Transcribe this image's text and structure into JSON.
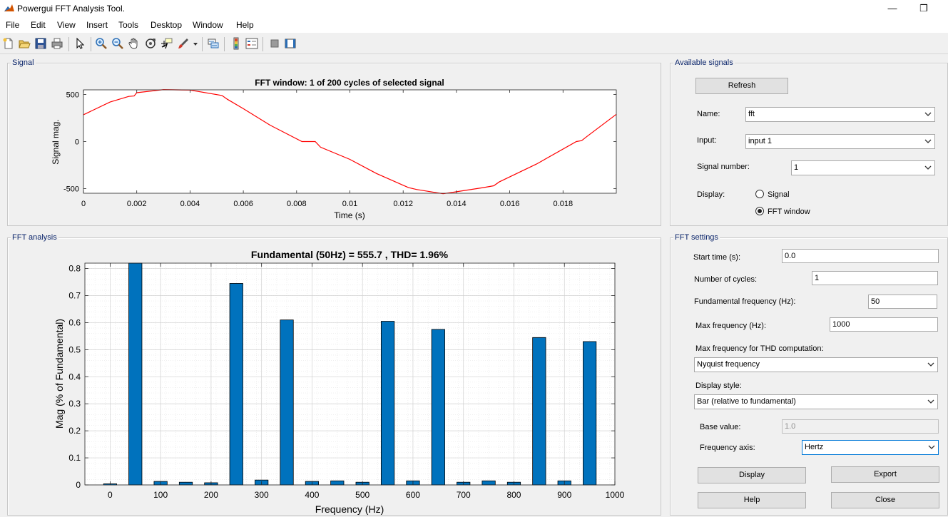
{
  "window": {
    "title": "Powergui FFT Analysis Tool.",
    "minimize_glyph": "—",
    "restore_glyph": "❐"
  },
  "menu": [
    "File",
    "Edit",
    "View",
    "Insert",
    "Tools",
    "Desktop",
    "Window",
    "Help"
  ],
  "toolbar_icons": [
    "new-figure-icon",
    "open-icon",
    "save-icon",
    "print-icon",
    "pointer-icon",
    "zoom-in-icon",
    "zoom-out-icon",
    "pan-icon",
    "rotate-icon",
    "data-cursor-icon",
    "brush-icon",
    "link-icon",
    "colorbar-icon",
    "legend-icon",
    "hide-plot-tools-icon",
    "show-plot-tools-icon"
  ],
  "signal_panel": {
    "title": "Signal"
  },
  "fft_panel": {
    "title": "FFT analysis"
  },
  "available_signals": {
    "title": "Available signals",
    "refresh_label": "Refresh",
    "name_label": "Name:",
    "name_value": "fft",
    "input_label": "Input:",
    "input_value": "input 1",
    "signal_number_label": "Signal number:",
    "signal_number_value": "1",
    "display_label": "Display:",
    "radio_signal": "Signal",
    "radio_fft_window": "FFT window",
    "selected": "FFT window"
  },
  "fft_settings": {
    "title": "FFT settings",
    "start_time_label": "Start time (s):",
    "start_time_value": "0.0",
    "num_cycles_label": "Number of cycles:",
    "num_cycles_value": "1",
    "fund_freq_label": "Fundamental frequency (Hz):",
    "fund_freq_value": "50",
    "max_freq_label": "Max frequency (Hz):",
    "max_freq_value": "1000",
    "thd_label": "Max frequency for THD computation:",
    "thd_value": "Nyquist frequency",
    "display_style_label": "Display style:",
    "display_style_value": "Bar (relative to fundamental)",
    "base_value_label": "Base value:",
    "base_value_value": "1.0",
    "freq_axis_label": "Frequency axis:",
    "freq_axis_value": "Hertz",
    "display_button": "Display",
    "export_button": "Export",
    "help_button": "Help",
    "close_button": "Close"
  },
  "chart_data": [
    {
      "type": "line",
      "title": "FFT window: 1 of 200 cycles of selected signal",
      "xlabel": "Time (s)",
      "ylabel": "Signal mag.",
      "xlim": [
        0,
        0.02
      ],
      "ylim": [
        -550,
        550
      ],
      "xticks": [
        0,
        0.002,
        0.004,
        0.006,
        0.008,
        0.01,
        0.012,
        0.014,
        0.016,
        0.018
      ],
      "xtick_labels": [
        "0",
        "0.002",
        "0.004",
        "0.006",
        "0.008",
        "0.01",
        "0.012",
        "0.014",
        "0.016",
        "0.018"
      ],
      "yticks": [
        -500,
        0,
        500
      ],
      "ytick_labels": [
        "-500",
        "0",
        "500"
      ],
      "grid": false,
      "line_color": "#ff0000",
      "series": [
        {
          "x": [
            0,
            0.001,
            0.0017,
            0.0019,
            0.002,
            0.003,
            0.004,
            0.0052,
            0.0054,
            0.006,
            0.007,
            0.0082,
            0.0087,
            0.0089,
            0.01,
            0.011,
            0.012,
            0.0122,
            0.0125,
            0.0135,
            0.015,
            0.0154,
            0.0156,
            0.017,
            0.0185,
            0.0187,
            0.0189,
            0.02
          ],
          "y": [
            285,
            420,
            480,
            485,
            520,
            552,
            548,
            490,
            450,
            350,
            175,
            0,
            0,
            -60,
            -190,
            -340,
            -465,
            -490,
            -510,
            -555,
            -490,
            -470,
            -430,
            -240,
            0,
            10,
            55,
            290
          ]
        }
      ]
    },
    {
      "type": "bar",
      "title": "Fundamental (50Hz) = 555.7 , THD= 1.96%",
      "xlabel": "Frequency (Hz)",
      "ylabel": "Mag (% of Fundamental)",
      "xlim": [
        -50,
        1000
      ],
      "ylim": [
        0,
        0.82
      ],
      "xticks": [
        0,
        100,
        200,
        300,
        400,
        500,
        600,
        700,
        800,
        900,
        1000
      ],
      "xtick_labels": [
        "0",
        "100",
        "200",
        "300",
        "400",
        "500",
        "600",
        "700",
        "800",
        "900",
        "1000"
      ],
      "yticks": [
        0,
        0.1,
        0.2,
        0.3,
        0.4,
        0.5,
        0.6,
        0.7,
        0.8
      ],
      "ytick_labels": [
        "0",
        "0.1",
        "0.2",
        "0.3",
        "0.4",
        "0.5",
        "0.6",
        "0.7",
        "0.8"
      ],
      "grid": true,
      "bar_color": "#0072bd",
      "x": [
        0,
        50,
        100,
        150,
        200,
        250,
        300,
        350,
        400,
        450,
        500,
        550,
        600,
        650,
        700,
        750,
        800,
        850,
        900,
        950
      ],
      "values": [
        0.004,
        0.83,
        0.013,
        0.01,
        0.008,
        0.745,
        0.018,
        0.61,
        0.013,
        0.015,
        0.01,
        0.605,
        0.015,
        0.575,
        0.01,
        0.015,
        0.01,
        0.545,
        0.015,
        0.53
      ]
    }
  ]
}
